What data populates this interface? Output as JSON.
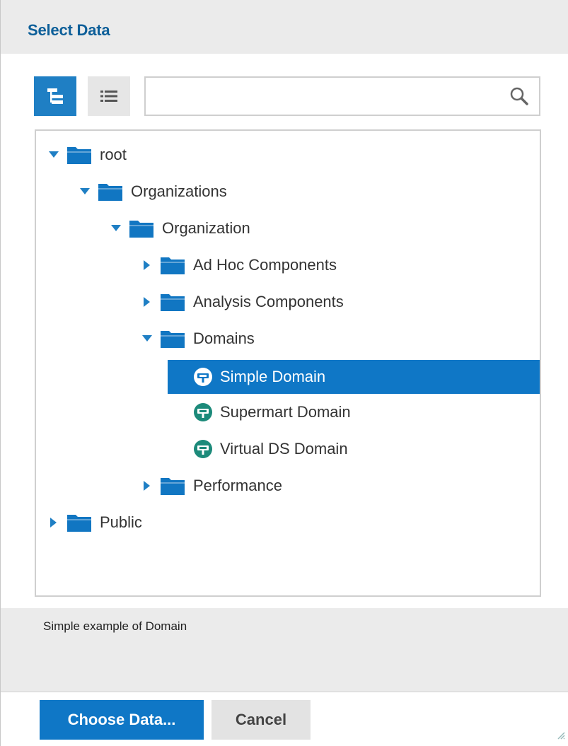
{
  "dialog": {
    "title": "Select Data",
    "search": {
      "value": "",
      "placeholder": ""
    },
    "tree": [
      {
        "label": "root",
        "type": "folder",
        "expanded": true,
        "level": 0
      },
      {
        "label": "Organizations",
        "type": "folder",
        "expanded": true,
        "level": 1
      },
      {
        "label": "Organization",
        "type": "folder",
        "expanded": true,
        "level": 2
      },
      {
        "label": "Ad Hoc Components",
        "type": "folder",
        "expanded": false,
        "level": 3
      },
      {
        "label": "Analysis Components",
        "type": "folder",
        "expanded": false,
        "level": 3
      },
      {
        "label": "Domains",
        "type": "folder",
        "expanded": true,
        "level": 3
      },
      {
        "label": "Simple Domain",
        "type": "domain",
        "selected": true,
        "level": 4
      },
      {
        "label": "Supermart Domain",
        "type": "domain",
        "level": 4
      },
      {
        "label": "Virtual DS Domain",
        "type": "domain",
        "level": 4
      },
      {
        "label": "Performance",
        "type": "folder",
        "expanded": false,
        "level": 3
      },
      {
        "label": "Public",
        "type": "folder",
        "expanded": false,
        "level": 0
      }
    ],
    "description": "Simple example of Domain",
    "buttons": {
      "choose": "Choose Data...",
      "cancel": "Cancel"
    },
    "colors": {
      "accent": "#0f77c6",
      "title": "#0d5f99",
      "domain_icon": "#1c8a7a"
    }
  }
}
